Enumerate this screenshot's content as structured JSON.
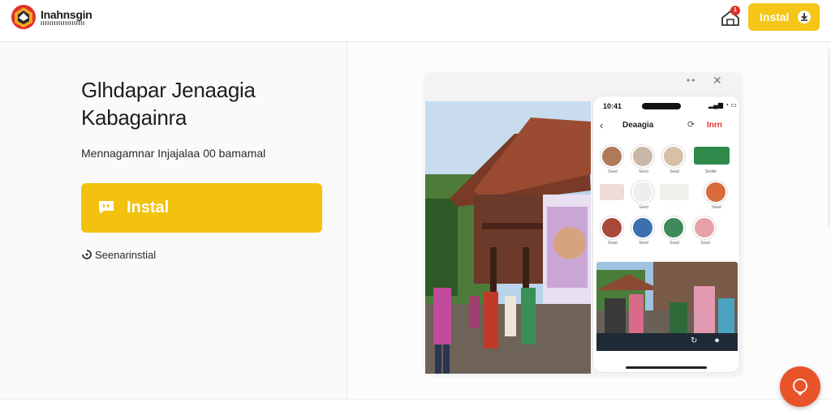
{
  "header": {
    "logo_name": "Inahnsgin",
    "logo_subtitle": "IIIIIIIIIIIIIIIIIIII",
    "notification_count": "1",
    "install_label": "Instal"
  },
  "hero": {
    "headline_line1": "Glhdapar Jenaagia",
    "headline_line2": "Kabagainra",
    "subtitle": "Mennagamnar Injajalaa 00 bamamal",
    "cta_label": "Instal",
    "secondary_label": "Seenarinstial"
  },
  "preview": {
    "phone": {
      "time": "10:41",
      "title": "Deaagia",
      "brand": "Inrn",
      "grid_labels": [
        "Seed",
        "Seed",
        "Sead",
        "Sedite",
        "",
        "Seed",
        "",
        "Sead",
        "Sead",
        "Seed",
        "Sead",
        "Sead"
      ]
    }
  },
  "colors": {
    "accent": "#f2c20e",
    "fab": "#e8532a",
    "brand_red": "#e0302a"
  },
  "icons": {
    "logo": "brand-logo-icon",
    "notification": "bell-icon",
    "install": "download-icon",
    "cta": "chat-icon",
    "secondary": "loading-icon",
    "fab": "chat-bubble-icon"
  }
}
